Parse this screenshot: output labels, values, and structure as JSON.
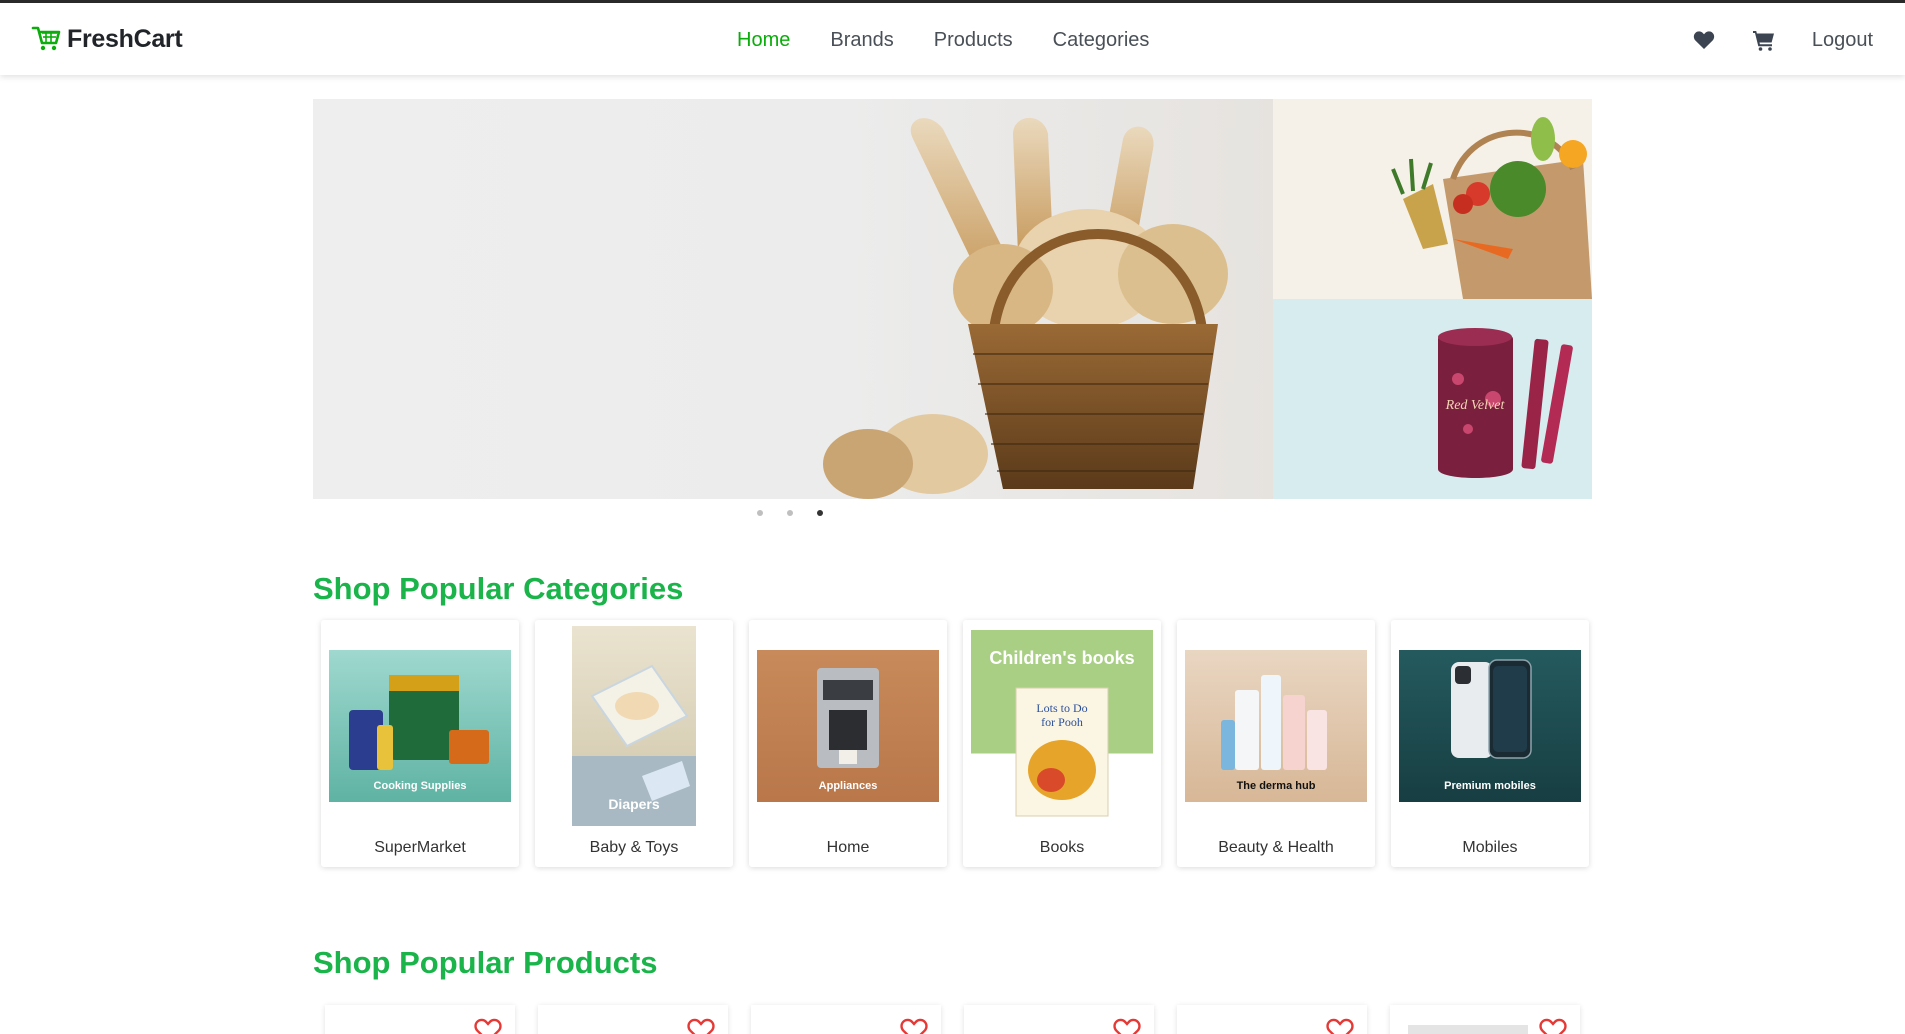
{
  "brand": {
    "name": "FreshCart",
    "icon": "cart-icon"
  },
  "nav": {
    "links": [
      {
        "label": "Home",
        "active": true
      },
      {
        "label": "Brands",
        "active": false
      },
      {
        "label": "Products",
        "active": false
      },
      {
        "label": "Categories",
        "active": false
      }
    ],
    "logout_label": "Logout",
    "wishlist_icon": "heart-icon",
    "cart_icon": "cart-icon"
  },
  "slider": {
    "slides_count": 3,
    "active_slide": 3,
    "side_top_caption": "",
    "side_bottom_caption": ""
  },
  "categories": {
    "title": "Shop Popular Categories",
    "items": [
      {
        "name": "SuperMarket",
        "image_caption": "Cooking Supplies"
      },
      {
        "name": "Baby & Toys",
        "image_caption": "Diapers"
      },
      {
        "name": "Home",
        "image_caption": "Appliances"
      },
      {
        "name": "Books",
        "image_caption": "Children's books"
      },
      {
        "name": "Beauty & Health",
        "image_caption": "The derma hub"
      },
      {
        "name": "Mobiles",
        "image_caption": "Premium mobiles"
      }
    ]
  },
  "products": {
    "title": "Shop Popular Products",
    "wishlist_icon": "heart-outline-icon"
  },
  "colors": {
    "accent": "#0aad0a",
    "title_green": "#1ab44a",
    "heart_red": "#e53935"
  }
}
